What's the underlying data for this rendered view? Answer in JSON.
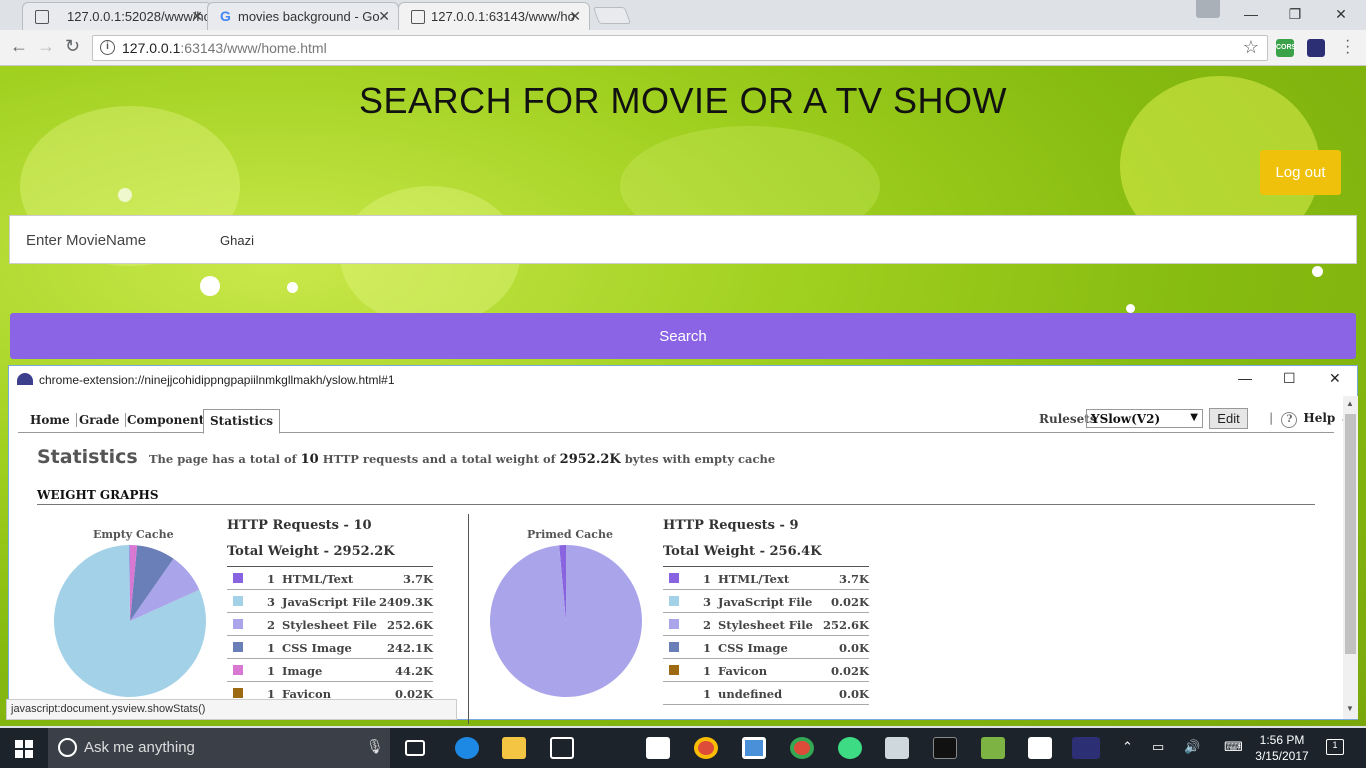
{
  "browser": {
    "tabs": [
      {
        "title": "127.0.0.1:52028/www/ho"
      },
      {
        "title": "movies background - Go"
      },
      {
        "title": "127.0.0.1:63143/www/ho"
      }
    ],
    "url_host": "127.0.0.1",
    "url_rest": ":63143/www/home.html",
    "extensions": [
      "CORS",
      "yslow"
    ]
  },
  "page": {
    "heading": "SEARCH FOR MOVIE OR A TV SHOW",
    "logout_label": "Log out",
    "search_label": "Enter MovieName",
    "search_value": "Ghazi",
    "search_button": "Search"
  },
  "yslow": {
    "window_title": "chrome-extension://ninejjcohidippngpapiilnmkgllmakh/yslow.html#1",
    "tabs": [
      "Home",
      "Grade",
      "Components",
      "Statistics"
    ],
    "active_tab": "Statistics",
    "rulesets_label": "Rulesets",
    "ruleset_value": "YSlow(V2)",
    "edit_label": "Edit",
    "help_label": "Help ↓",
    "stats_title": "Statistics",
    "desc_pre": "The page has a total of",
    "desc_requests": "10",
    "desc_mid": "HTTP requests and a total weight of",
    "desc_weight": "2952.2K",
    "desc_post": "bytes with empty cache",
    "weight_graphs": "WEIGHT GRAPHS",
    "empty": {
      "label": "Empty Cache",
      "requests": "HTTP Requests - 10",
      "weight": "Total Weight - 2952.2K",
      "rows": [
        {
          "count": "1",
          "name": "HTML/Text",
          "size": "3.7K",
          "color": "#8a63e0",
          "kb": 3.7
        },
        {
          "count": "3",
          "name": "JavaScript File",
          "size": "2409.3K",
          "color": "#a3d1e8",
          "kb": 2409.3
        },
        {
          "count": "2",
          "name": "Stylesheet File",
          "size": "252.6K",
          "color": "#aaa5ea",
          "kb": 252.6
        },
        {
          "count": "1",
          "name": "CSS Image",
          "size": "242.1K",
          "color": "#6a7fb8",
          "kb": 242.1
        },
        {
          "count": "1",
          "name": "Image",
          "size": "44.2K",
          "color": "#d978d2",
          "kb": 44.2
        },
        {
          "count": "1",
          "name": "Favicon",
          "size": "0.02K",
          "color": "#9c6a13",
          "kb": 0.02
        }
      ]
    },
    "primed": {
      "label": "Primed Cache",
      "requests": "HTTP Requests - 9",
      "weight": "Total Weight - 256.4K",
      "rows": [
        {
          "count": "1",
          "name": "HTML/Text",
          "size": "3.7K",
          "color": "#8a63e0",
          "kb": 3.7
        },
        {
          "count": "3",
          "name": "JavaScript File",
          "size": "0.02K",
          "color": "#a3d1e8",
          "kb": 0.02
        },
        {
          "count": "2",
          "name": "Stylesheet File",
          "size": "252.6K",
          "color": "#aaa5ea",
          "kb": 252.6
        },
        {
          "count": "1",
          "name": "CSS Image",
          "size": "0.0K",
          "color": "#6a7fb8",
          "kb": 0
        },
        {
          "count": "1",
          "name": "Favicon",
          "size": "0.02K",
          "color": "#9c6a13",
          "kb": 0.02
        },
        {
          "count": "1",
          "name": "undefined",
          "size": "0.0K",
          "color": "",
          "kb": 0
        }
      ]
    }
  },
  "status_text": "javascript:document.ysview.showStats()",
  "taskbar": {
    "search_placeholder": "Ask me anything",
    "time": "1:56 PM",
    "date": "3/15/2017",
    "notification_count": "1"
  }
}
